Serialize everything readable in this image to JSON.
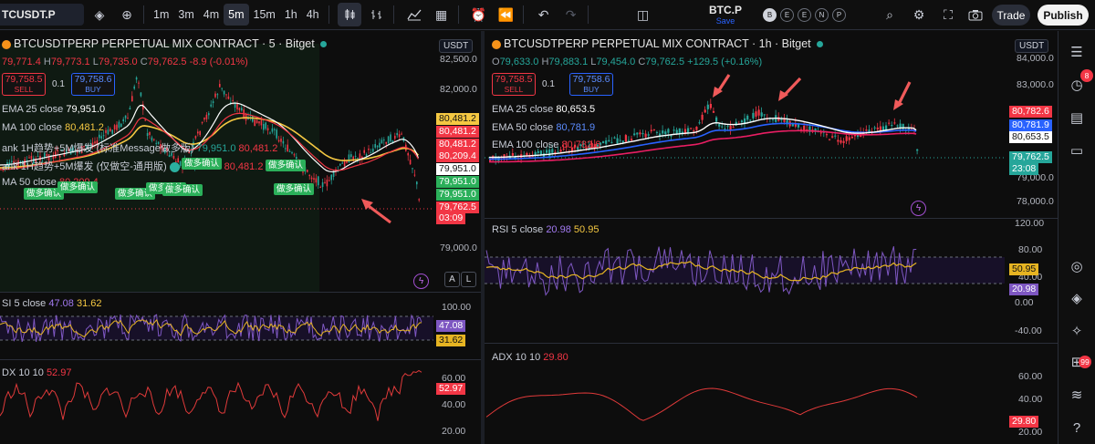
{
  "toolbar": {
    "symbol": "TCUSDT.P",
    "timeframes": [
      "1m",
      "3m",
      "4m",
      "5m",
      "15m",
      "1h",
      "4h"
    ],
    "active_timeframe": "5m",
    "center_symbol": "BTC.P",
    "save_label": "Save",
    "circle_buttons": [
      "B",
      "E",
      "E",
      "N",
      "P"
    ],
    "trade_label": "Trade",
    "publish_label": "Publish"
  },
  "left_chart": {
    "title": "BTCUSDTPERP PERPETUAL MIX CONTRACT · 5 · Bitget",
    "ohlc": {
      "o": "79,771.4",
      "h_key": "H",
      "h": "79,773.1",
      "l_key": "L",
      "l": "79,735.0",
      "c_key": "C",
      "c": "79,762.5",
      "change": "-8.9 (-0.01%)"
    },
    "currency": "USDT",
    "sell": {
      "price": "79,758.5",
      "label": "SELL"
    },
    "spread": "0.1",
    "buy": {
      "price": "79,758.6",
      "label": "BUY"
    },
    "indicators": {
      "ema25": {
        "label": "EMA 25 close",
        "value": "79,951.0"
      },
      "ema100": {
        "label": "MA 100 close",
        "value": "80,481.2"
      },
      "strat1": {
        "label": "ank 1H趋势+5M爆发 (标准Message做多版)",
        "v1": "79,951.0",
        "v2": "80,481.2"
      },
      "strat2": {
        "label": "ank 1H趋势+5M爆发 (仅做空-通用版)",
        "v1": "79,951.0",
        "v2": "80,481.2"
      },
      "ma50": {
        "label": "MA 50 close",
        "value": "80,209.4"
      }
    },
    "signals": [
      "做多确认",
      "做多确认",
      "做多确认",
      "做多确认",
      "做多确认",
      "做多确认",
      "做多确认",
      "做多确认"
    ],
    "price_axis": [
      "82,500.0",
      "82,000.0",
      "79,000.0"
    ],
    "price_tags": [
      {
        "text": "80,481.2",
        "color": "#f5c842"
      },
      {
        "text": "80,481.2",
        "color": "#f23645"
      },
      {
        "text": "80,481.2",
        "color": "#f23645"
      },
      {
        "text": "80,209.4",
        "color": "#f23645"
      },
      {
        "text": "79,951.0",
        "color": "#ffffff"
      },
      {
        "text": "79,951.0",
        "color": "#2bb05a"
      },
      {
        "text": "79,951.0",
        "color": "#2bb05a"
      },
      {
        "text": "79,762.5",
        "color": "#f23645"
      },
      {
        "text": "03:09",
        "color": "#f23645"
      }
    ],
    "axis_btn_a": "A",
    "axis_btn_l": "L",
    "rsi": {
      "label": "SI 5 close",
      "v1": "47.08",
      "v2": "31.62",
      "axis": [
        "100.00"
      ],
      "tag1": "47.08",
      "tag2": "31.62"
    },
    "adx": {
      "label": "DX 10 10",
      "value": "52.97",
      "axis": [
        "60.00",
        "40.00",
        "20.00"
      ],
      "tag": "52.97"
    }
  },
  "right_chart": {
    "title": "BTCUSDTPERP PERPETUAL MIX CONTRACT · 1h · Bitget",
    "ohlc": {
      "o_key": "O",
      "o": "79,633.0",
      "h_key": "H",
      "h": "79,883.1",
      "l_key": "L",
      "l": "79,454.0",
      "c_key": "C",
      "c": "79,762.5",
      "change": "+129.5 (+0.16%)"
    },
    "currency": "USDT",
    "sell": {
      "price": "79,758.5",
      "label": "SELL"
    },
    "spread": "0.1",
    "buy": {
      "price": "79,758.6",
      "label": "BUY"
    },
    "indicators": {
      "ema25": {
        "label": "EMA 25 close",
        "value": "80,653.5"
      },
      "ema50": {
        "label": "EMA 50 close",
        "value": "80,781.9"
      },
      "ema100": {
        "label": "EMA 100 close",
        "value": "80,782.6"
      }
    },
    "price_axis": [
      "84,000.0",
      "83,000.0",
      "82,000.0",
      "81,000.0",
      "80,000.0",
      "79,000.0",
      "78,000.0"
    ],
    "price_tags": [
      {
        "text": "80,782.6",
        "color": "#f23645"
      },
      {
        "text": "80,781.9",
        "color": "#2962ff"
      },
      {
        "text": "80,653.5",
        "color": "#ffffff"
      },
      {
        "text": "79,762.5",
        "color": "#26a69a"
      },
      {
        "text": "23:08",
        "color": "#26a69a"
      }
    ],
    "rsi": {
      "label": "RSI 5 close",
      "v1": "20.98",
      "v2": "50.95",
      "axis": [
        "120.00",
        "80.00",
        "40.00",
        "0.00",
        "-40.00"
      ],
      "tag1": "50.95",
      "tag2": "20.98"
    },
    "adx": {
      "label": "ADX 10 10",
      "value": "29.80",
      "axis": [
        "60.00",
        "40.00",
        "20.00"
      ],
      "tag": "29.80"
    }
  },
  "sidebar": {
    "icons": [
      "watchlist-icon",
      "alerts-icon",
      "calendar-icon",
      "chat-icon",
      "target-icon",
      "layers-icon",
      "idea-icon",
      "grid-icon",
      "broadcast-icon",
      "help-icon"
    ],
    "badge_alerts": "8",
    "badge_broadcast": "99"
  },
  "colors": {
    "up": "#26a69a",
    "down": "#f23645",
    "ema_yellow": "#f5c842",
    "ema_white": "#ffffff",
    "ema_blue": "#2962ff",
    "ema_red": "#e91e63",
    "rsi_purple": "#7e57c2",
    "rsi_yellow": "#e6b422",
    "adx_red": "#e03a3a",
    "arrow": "#f05a5a"
  }
}
